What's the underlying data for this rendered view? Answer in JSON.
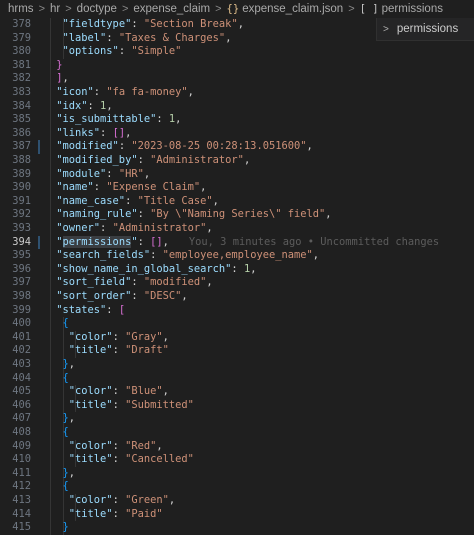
{
  "breadcrumb": {
    "items": [
      "hrms",
      "hr",
      "doctype",
      "expense_claim",
      "expense_claim.json",
      "permissions"
    ],
    "json_icon": "{}",
    "array_icon": "[ ]",
    "separator": ">"
  },
  "sticky_scroll": {
    "label": "permissions",
    "chevron": ">"
  },
  "editor": {
    "active_line": 394,
    "blame": "You, 3 minutes ago • Uncommitted changes",
    "lines": [
      {
        "n": "378"
      },
      {
        "n": "379"
      },
      {
        "n": "380"
      },
      {
        "n": "381"
      },
      {
        "n": "382"
      },
      {
        "n": "383"
      },
      {
        "n": "384"
      },
      {
        "n": "385"
      },
      {
        "n": "386"
      },
      {
        "n": "387"
      },
      {
        "n": "388"
      },
      {
        "n": "389"
      },
      {
        "n": "390"
      },
      {
        "n": "391"
      },
      {
        "n": "392"
      },
      {
        "n": "393"
      },
      {
        "n": "394"
      },
      {
        "n": "395"
      },
      {
        "n": "396"
      },
      {
        "n": "397"
      },
      {
        "n": "398"
      },
      {
        "n": "399"
      },
      {
        "n": "400"
      },
      {
        "n": "401"
      },
      {
        "n": "402"
      },
      {
        "n": "403"
      },
      {
        "n": "404"
      },
      {
        "n": "405"
      },
      {
        "n": "406"
      },
      {
        "n": "407"
      },
      {
        "n": "408"
      },
      {
        "n": "409"
      },
      {
        "n": "410"
      },
      {
        "n": "411"
      },
      {
        "n": "412"
      },
      {
        "n": "413"
      },
      {
        "n": "414"
      },
      {
        "n": "415"
      }
    ],
    "tokens": {
      "378_k": "\"fieldtype\"",
      "378_v": "\"Section Break\"",
      "379_k": "\"label\"",
      "379_v": "\"Taxes & Charges\"",
      "380_k": "\"options\"",
      "380_v": "\"Simple\"",
      "383_k": "\"icon\"",
      "383_v": "\"fa fa-money\"",
      "384_k": "\"idx\"",
      "384_v": "1",
      "385_k": "\"is_submittable\"",
      "385_v": "1",
      "386_k": "\"links\"",
      "387_k": "\"modified\"",
      "387_v": "\"2023-08-25 00:28:13.051600\"",
      "388_k": "\"modified_by\"",
      "388_v": "\"Administrator\"",
      "389_k": "\"module\"",
      "389_v": "\"HR\"",
      "390_k": "\"name\"",
      "390_v": "\"Expense Claim\"",
      "391_k": "\"name_case\"",
      "391_v": "\"Title Case\"",
      "392_k": "\"naming_rule\"",
      "392_v": "\"By \\\"Naming Series\\\" field\"",
      "393_k": "\"owner\"",
      "393_v": "\"Administrator\"",
      "394_k": "permissions",
      "395_k": "\"search_fields\"",
      "395_v": "\"employee,employee_name\"",
      "396_k": "\"show_name_in_global_search\"",
      "396_v": "1",
      "397_k": "\"sort_field\"",
      "397_v": "\"modified\"",
      "398_k": "\"sort_order\"",
      "398_v": "\"DESC\"",
      "399_k": "\"states\"",
      "401_k": "\"color\"",
      "401_v": "\"Gray\"",
      "402_k": "\"title\"",
      "402_v": "\"Draft\"",
      "405_k": "\"color\"",
      "405_v": "\"Blue\"",
      "406_k": "\"title\"",
      "406_v": "\"Submitted\"",
      "409_k": "\"color\"",
      "409_v": "\"Red\"",
      "410_k": "\"title\"",
      "410_v": "\"Cancelled\"",
      "413_k": "\"color\"",
      "413_v": "\"Green\"",
      "414_k": "\"title\"",
      "414_v": "\"Paid\""
    }
  }
}
